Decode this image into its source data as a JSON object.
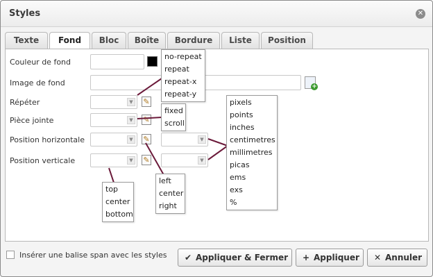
{
  "dialog": {
    "title": "Styles"
  },
  "tabs": [
    "Texte",
    "Fond",
    "Bloc",
    "Boîte",
    "Bordure",
    "Liste",
    "Position"
  ],
  "fields": {
    "background_color": "Couleur de fond",
    "background_image": "Image de fond",
    "repeat": "Répéter",
    "attachment": "Pièce jointe",
    "horizontal_position": "Position horizontale",
    "vertical_position": "Position verticale"
  },
  "dropdowns": {
    "repeat_options": [
      "no-repeat",
      "repeat",
      "repeat-x",
      "repeat-y"
    ],
    "attachment_options": [
      "fixed",
      "scroll"
    ],
    "units": [
      "pixels",
      "points",
      "inches",
      "centimetres",
      "millimetres",
      "picas",
      "ems",
      "exs",
      "%"
    ],
    "horizontal_options": [
      "left",
      "center",
      "right"
    ],
    "vertical_options": [
      "top",
      "center",
      "bottom"
    ]
  },
  "footer": {
    "span_checkbox_label": "Insérer une balise span avec les styles",
    "apply_close": "Appliquer & Fermer",
    "apply": "Appliquer",
    "cancel": "Annuler"
  },
  "icons": {
    "close": "close-icon",
    "dropdown": "chevron-down-icon",
    "edit": "pencil-icon",
    "image": "image-add-icon",
    "check": "check-icon",
    "plus": "plus-icon",
    "cross": "cross-icon"
  },
  "colors": {
    "connector_line": "#6b1a3a",
    "selected_color_swatch": "#000000"
  }
}
